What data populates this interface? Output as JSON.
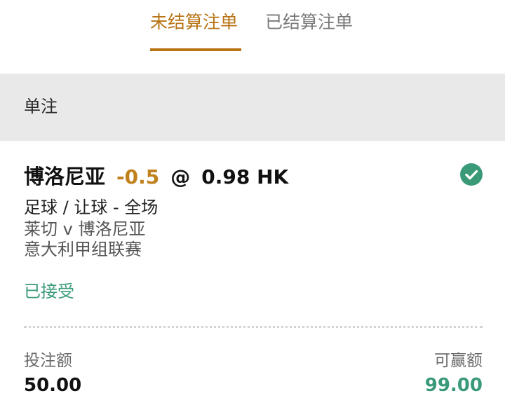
{
  "tabs": {
    "open_bets": "未结算注单",
    "settled_bets": "已结算注单"
  },
  "section": {
    "title": "单注"
  },
  "bet": {
    "selection": "博洛尼亚",
    "handicap": "-0.5",
    "at": "@",
    "odds": "0.98 HK",
    "market": "足球 / 让球 - 全场",
    "event": "莱切 v 博洛尼亚",
    "league": "意大利甲组联赛",
    "status": "已接受",
    "status_icon": "check-circle-icon",
    "stake_label": "投注额",
    "stake_value": "50.00",
    "win_label": "可赢额",
    "win_value": "99.00"
  },
  "colors": {
    "accent": "#b87314",
    "handicap": "#c0801a",
    "success": "#3a9a78",
    "section_bg": "#e9e9e9"
  }
}
